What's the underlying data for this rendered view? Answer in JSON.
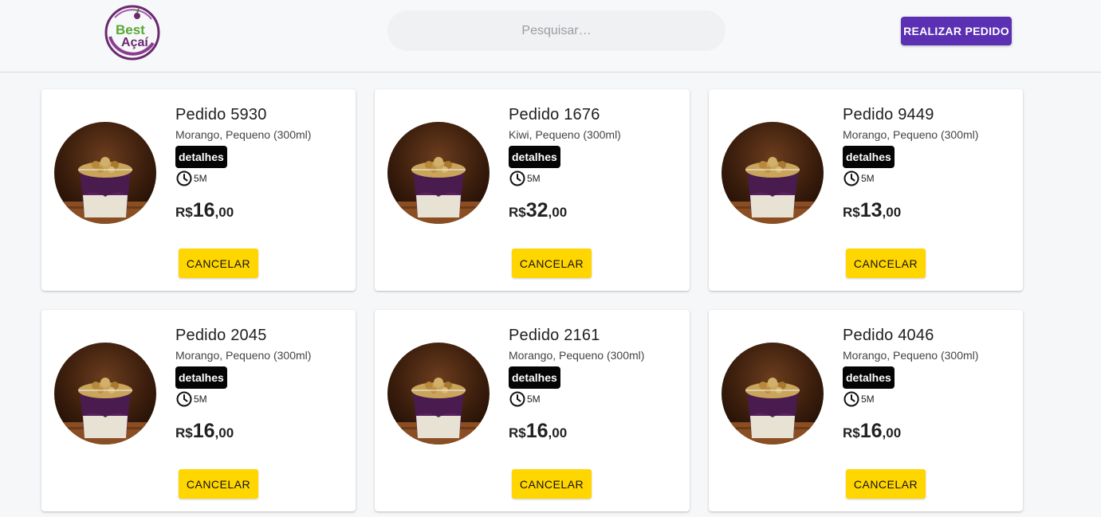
{
  "header": {
    "logo_text_top": "Best",
    "logo_text_bottom": "Açaí",
    "search_placeholder": "Pesquisar…",
    "order_button": "REALIZAR PEDIDO"
  },
  "colors": {
    "primary": "#5b30b3",
    "accent_yellow": "#ffd600",
    "badge_black": "#050505"
  },
  "orders": [
    {
      "title": "Pedido 5930",
      "description": "Morango, Pequeno (300ml)",
      "details": "detalhes",
      "time": "5M",
      "currency": "R$",
      "price_int": "16",
      "price_dec": ",00",
      "cancel": "CANCELAR",
      "image_icon": "acai-cup-photo"
    },
    {
      "title": "Pedido 1676",
      "description": "Kiwi, Pequeno (300ml)",
      "details": "detalhes",
      "time": "5M",
      "currency": "R$",
      "price_int": "32",
      "price_dec": ",00",
      "cancel": "CANCELAR",
      "image_icon": "acai-cup-photo"
    },
    {
      "title": "Pedido 9449",
      "description": "Morango, Pequeno (300ml)",
      "details": "detalhes",
      "time": "5M",
      "currency": "R$",
      "price_int": "13",
      "price_dec": ",00",
      "cancel": "CANCELAR",
      "image_icon": "acai-cup-photo"
    },
    {
      "title": "Pedido 2045",
      "description": "Morango, Pequeno (300ml)",
      "details": "detalhes",
      "time": "5M",
      "currency": "R$",
      "price_int": "16",
      "price_dec": ",00",
      "cancel": "CANCELAR",
      "image_icon": "acai-cup-photo"
    },
    {
      "title": "Pedido 2161",
      "description": "Morango, Pequeno (300ml)",
      "details": "detalhes",
      "time": "5M",
      "currency": "R$",
      "price_int": "16",
      "price_dec": ",00",
      "cancel": "CANCELAR",
      "image_icon": "acai-cup-photo"
    },
    {
      "title": "Pedido 4046",
      "description": "Morango, Pequeno (300ml)",
      "details": "detalhes",
      "time": "5M",
      "currency": "R$",
      "price_int": "16",
      "price_dec": ",00",
      "cancel": "CANCELAR",
      "image_icon": "acai-cup-photo"
    }
  ]
}
